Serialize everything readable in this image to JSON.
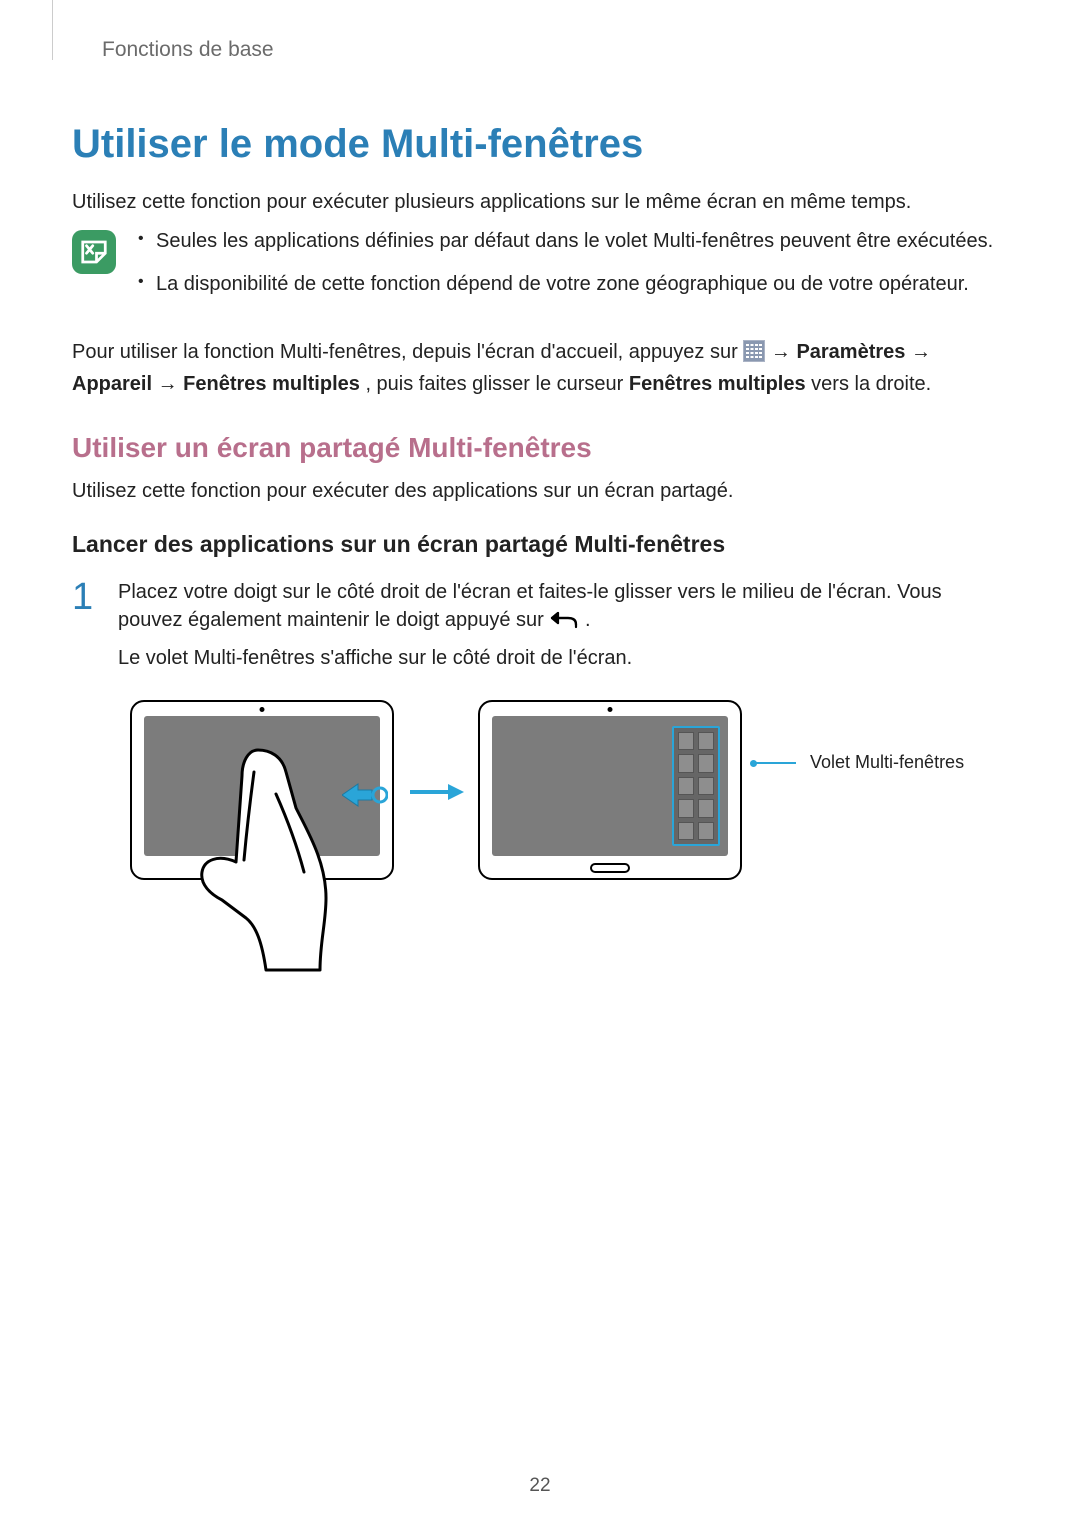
{
  "breadcrumb": "Fonctions de base",
  "title": "Utiliser le mode Multi-fenêtres",
  "intro": "Utilisez cette fonction pour exécuter plusieurs applications sur le même écran en même temps.",
  "notes": [
    "Seules les applications définies par défaut dans le volet Multi-fenêtres peuvent être exécutées.",
    "La disponibilité de cette fonction dépend de votre zone géographique ou de votre opérateur."
  ],
  "para2": {
    "pre": "Pour utiliser la fonction Multi-fenêtres, depuis l'écran d'accueil, appuyez sur ",
    "arrow1": " → ",
    "bold1": "Paramètres",
    "arrow2": " → ",
    "bold2": "Appareil",
    "arrow3": " → ",
    "bold3": "Fenêtres multiples",
    "mid": ", puis faites glisser le curseur ",
    "bold4": "Fenêtres multiples",
    "post": " vers la droite."
  },
  "subheading": "Utiliser un écran partagé Multi-fenêtres",
  "subheading_body": "Utilisez cette fonction pour exécuter des applications sur un écran partagé.",
  "subsub": "Lancer des applications sur un écran partagé Multi-fenêtres",
  "step1": {
    "num": "1",
    "p1_pre": "Placez votre doigt sur le côté droit de l'écran et faites-le glisser vers le milieu de l'écran. Vous pouvez également maintenir le doigt appuyé sur ",
    "p1_post": ".",
    "p2": "Le volet Multi-fenêtres s'affiche sur le côté droit de l'écran."
  },
  "callout": "Volet Multi-fenêtres",
  "page_number": "22"
}
